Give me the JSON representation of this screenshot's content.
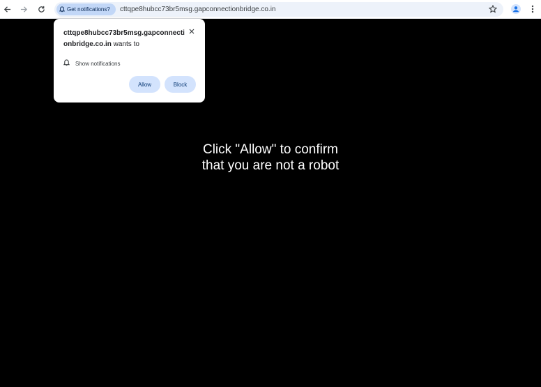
{
  "browser": {
    "permission_chip": "Get notifications?",
    "url": "cttqpe8hubcc73br5msg.gapconnectionbridge.co.in",
    "icons": {
      "back": "arrow-left-icon",
      "forward": "arrow-right-icon",
      "reload": "reload-icon",
      "bookmark": "star-icon",
      "profile": "profile-icon",
      "menu": "kebab-menu-icon"
    }
  },
  "popup": {
    "site": "cttqpe8hubcc73br5msg.gapconnectionbridge.co.in",
    "wants_to": " wants to",
    "permission": "Show notifications",
    "allow_label": "Allow",
    "block_label": "Block"
  },
  "page": {
    "message_line1": "Click \"Allow\" to confirm",
    "message_line2": "that you are not a robot"
  },
  "colors": {
    "page_background": "#000000",
    "chip_background": "#c2d7f7",
    "button_background": "#d3e3fd",
    "profile_accent": "#1a73e8"
  }
}
